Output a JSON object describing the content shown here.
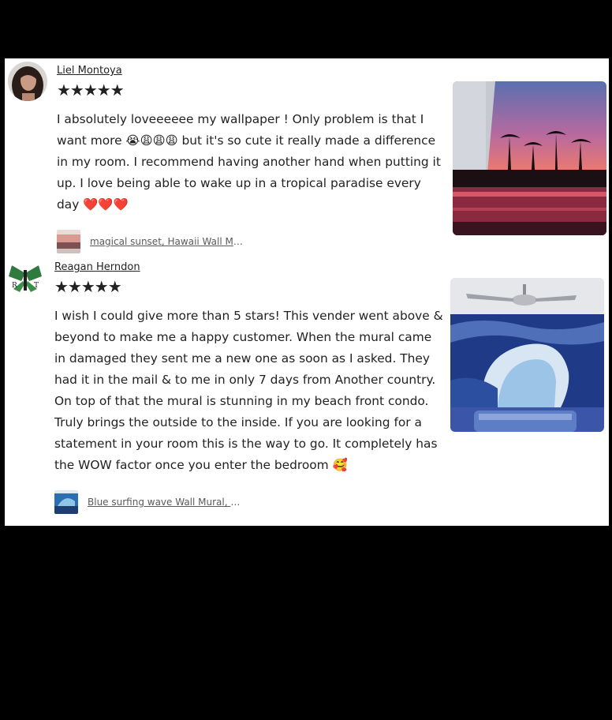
{
  "reviews": [
    {
      "name": "Liel Montoya",
      "stars": "★★★★★",
      "rating": 5,
      "text_part1": "I absolutely loveeeeee my wallpaper ! Only problem is that I want more 😭😩😩😩 but it's so cute it really made a difference in my room. I recommend having another hand when putting it up. I love being able to wake up in a tropical paradise every day ",
      "text_part2": "❤️❤️❤️",
      "product": "magical sunset, Hawaii Wall Mural, Self-Adhesive"
    },
    {
      "name": "Reagan Herndon",
      "stars": "★★★★★",
      "rating": 5,
      "text_part1": "I wish I could give more than 5 stars! This vender went above & beyond to make me a happy customer. When the mural came in damaged they sent me a new one as soon as I asked. They had it in the mail & to me in only 7 days from Another country. On top of that the mural is stunning in my beach front condo. Truly brings the outside to the inside. If you are looking for a statement in your room this is the way to go. It completely has the WOW factor once you enter the bedroom ",
      "text_part2": "🥰",
      "product": "Blue surfing wave Wall Mural, Self-Adhesive"
    }
  ],
  "colors": {
    "background": "#000000",
    "panel": "#ffffff",
    "text": "#222222",
    "link": "#595959"
  }
}
